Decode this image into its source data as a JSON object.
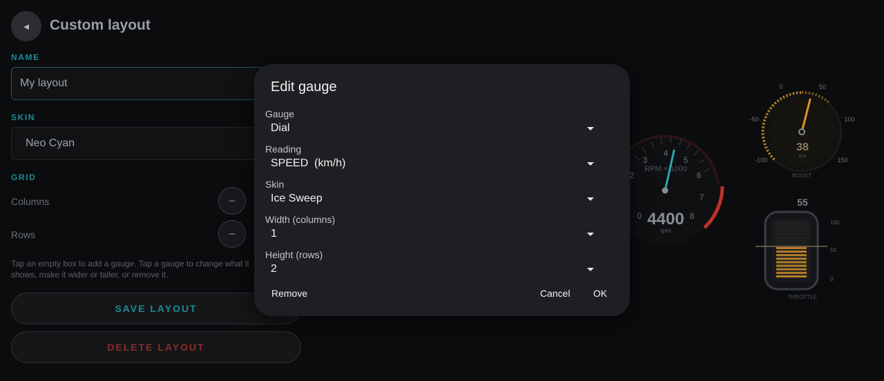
{
  "header": {
    "title": "Custom layout",
    "back_icon": "◄"
  },
  "name_section": {
    "label": "NAME",
    "value": "My layout"
  },
  "skin_section": {
    "label": "SKIN",
    "value": "Neo Cyan"
  },
  "grid_section": {
    "label": "GRID",
    "columns_label": "Columns",
    "rows_label": "Rows",
    "decrement_symbol": "–"
  },
  "hint": "Tap an empty box to add a gauge. Tap a gauge to change what it shows, make it wider or taller, or remove it.",
  "actions": {
    "save": "SAVE LAYOUT",
    "delete": "DELETE LAYOUT",
    "save_color": "#1f8a93",
    "delete_color": "#8a2e2a"
  },
  "gauges": {
    "rpm": {
      "value": "4400",
      "unit": "rpm",
      "caption": "RPM × 1000",
      "ticks": [
        "0",
        "2",
        "3",
        "4",
        "5",
        "6",
        "7",
        "8"
      ]
    },
    "boost": {
      "value": "38",
      "unit": "kPa",
      "caption": "BOOST",
      "ticks": [
        "-100",
        "-50",
        "0",
        "50",
        "100",
        "150"
      ]
    },
    "throttle": {
      "value": "55",
      "caption": "THROTTLE",
      "ticks": [
        "100",
        "50",
        "0"
      ],
      "level_fraction": 0.55
    }
  },
  "dialog": {
    "title": "Edit gauge",
    "fields": [
      {
        "label": "Gauge",
        "value": "Dial"
      },
      {
        "label": "Reading",
        "value": "SPEED  (km/h)"
      },
      {
        "label": "Skin",
        "value": "Ice Sweep"
      },
      {
        "label": "Width (columns)",
        "value": "1"
      },
      {
        "label": "Height (rows)",
        "value": "2"
      }
    ],
    "remove": "Remove",
    "cancel": "Cancel",
    "ok": "OK"
  },
  "colors": {
    "accent": "#1f8a93",
    "dialog_bg": "#1e1f22",
    "boost_amber": "#d8962a",
    "rpm_needle": "#2aa6b0",
    "redline": "#c0302a"
  }
}
